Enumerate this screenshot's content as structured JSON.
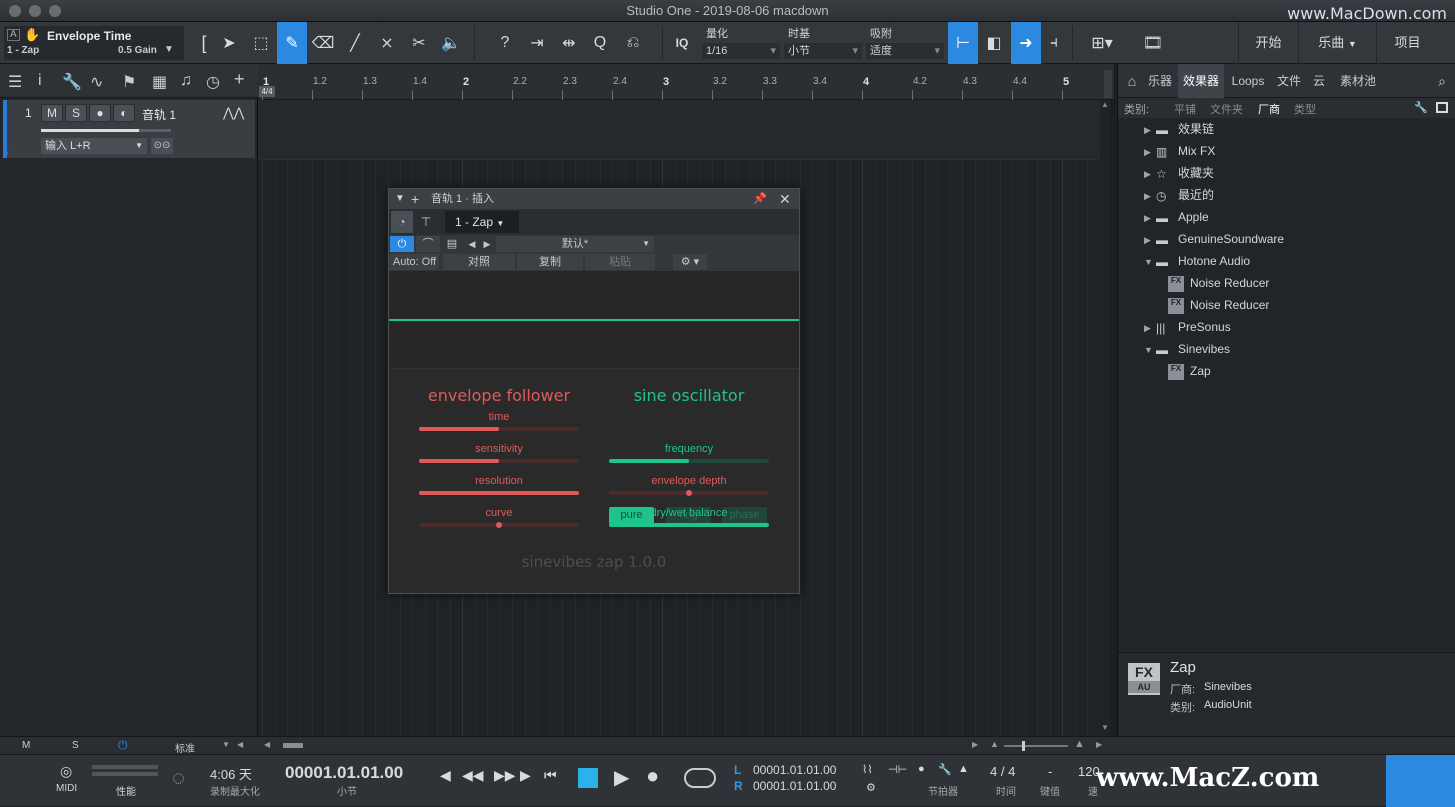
{
  "window": {
    "title": "Studio One - 2019-08-06 macdown",
    "watermark_top": "www.MacDown.com",
    "watermark_bottom": "www.MacZ.com"
  },
  "toolbar": {
    "param_name": "Envelope Time",
    "param_sub": "1 - Zap",
    "param_value": "0.5 Gain",
    "quantize_label": "量化",
    "quantize_value": "1/16",
    "timebase_label": "时基",
    "timebase_value": "小节",
    "snap_label": "吸附",
    "snap_value": "适度",
    "iq_label": "IQ",
    "start_btn": "开始",
    "song_btn": "乐曲",
    "project_btn": "项目"
  },
  "track": {
    "number": "1",
    "mute": "M",
    "solo": "S",
    "name": "音轨 1",
    "input": "输入 L+R"
  },
  "ruler": {
    "time_sig": "4/4",
    "marks": [
      "1",
      "1.2",
      "1.3",
      "1.4",
      "2",
      "2.2",
      "2.3",
      "2.4",
      "3",
      "3.2",
      "3.3",
      "3.4",
      "4",
      "4.2",
      "4.3",
      "4.4",
      "5"
    ]
  },
  "plugin": {
    "title": "音轨 1 · 插入",
    "device": "1 - Zap",
    "preset": "默认*",
    "auto": "Auto: Off",
    "compare": "对照",
    "copy": "复制",
    "paste": "粘贴",
    "env_title": "envelope follower",
    "osc_title": "sine oscillator",
    "env_params": [
      {
        "name": "time",
        "value": 0.5
      },
      {
        "name": "sensitivity",
        "value": 0.5
      },
      {
        "name": "resolution",
        "value": 1.0
      },
      {
        "name": "curve",
        "value": 0.5
      }
    ],
    "modes": [
      "pure",
      "ring",
      "phase"
    ],
    "osc_params": [
      {
        "name": "frequency",
        "value": 0.5
      },
      {
        "name": "envelope depth",
        "value": 0.5
      },
      {
        "name": "dry/wet balance",
        "value": 1.0
      }
    ],
    "footer": "sinevibes zap 1.0.0",
    "colors": {
      "env": "#e05a5a",
      "osc": "#1fc48a"
    }
  },
  "browser": {
    "tabs": [
      "乐器",
      "效果器",
      "Loops",
      "文件",
      "云",
      "素材池"
    ],
    "sort_label": "类别:",
    "sort_opts": [
      "平铺",
      "文件夹",
      "厂商",
      "类型"
    ],
    "tree": [
      {
        "label": "效果链",
        "level": 0,
        "tri": "▶",
        "icon": "folder"
      },
      {
        "label": "Mix FX",
        "level": 0,
        "tri": "▶",
        "icon": "mixfx"
      },
      {
        "label": "收藏夹",
        "level": 0,
        "tri": "▶",
        "icon": "star"
      },
      {
        "label": "最近的",
        "level": 0,
        "tri": "▶",
        "icon": "clock"
      },
      {
        "label": "Apple",
        "level": 0,
        "tri": "▶",
        "icon": "folder"
      },
      {
        "label": "GenuineSoundware",
        "level": 0,
        "tri": "▶",
        "icon": "folder"
      },
      {
        "label": "Hotone Audio",
        "level": 0,
        "tri": "▼",
        "icon": "folder"
      },
      {
        "label": "Noise Reducer",
        "level": 1,
        "tri": "",
        "icon": "fx"
      },
      {
        "label": "Noise Reducer",
        "level": 1,
        "tri": "",
        "icon": "fx"
      },
      {
        "label": "PreSonus",
        "level": 0,
        "tri": "▶",
        "icon": "presonus"
      },
      {
        "label": "Sinevibes",
        "level": 0,
        "tri": "▼",
        "icon": "folder"
      },
      {
        "label": "Zap",
        "level": 1,
        "tri": "",
        "icon": "fx"
      }
    ],
    "info": {
      "name": "Zap",
      "vendor_label": "厂商:",
      "vendor": "Sinevibes",
      "type_label": "类别:",
      "type": "AudioUnit",
      "badge_top": "FX",
      "badge_bottom": "AU"
    }
  },
  "status": {
    "m": "M",
    "s": "S",
    "mode": "标准"
  },
  "transport": {
    "midi": "MIDI",
    "perf": "性能",
    "record_time": "4:06 天",
    "record_label": "录制最大化",
    "position": "00001.01.01.00",
    "position_label": "小节",
    "loop_l": "00001.01.01.00",
    "loop_r": "00001.01.01.00",
    "l": "L",
    "r": "R",
    "metronome_label": "节拍器",
    "time_sig": "4 / 4",
    "time_sig_label": "时间",
    "key": "-",
    "key_label": "键值",
    "tempo": "120",
    "tempo_label": "速"
  }
}
